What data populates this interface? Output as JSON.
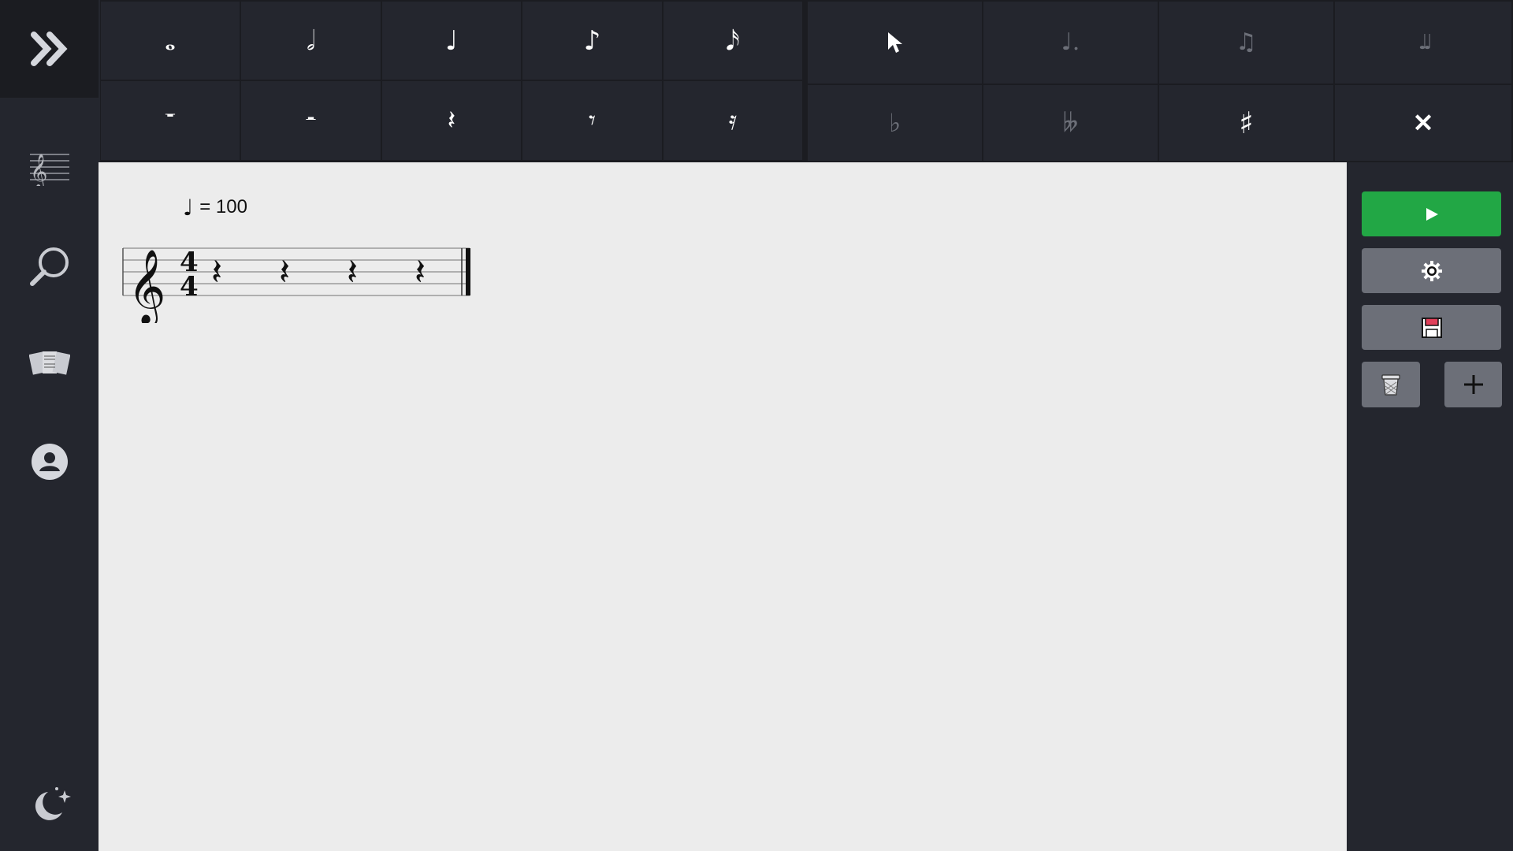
{
  "palette": {
    "durations": [
      {
        "name": "whole-note-icon",
        "glyph": "𝅝",
        "active": true
      },
      {
        "name": "half-note-icon",
        "glyph": "𝅗𝅥",
        "active": true
      },
      {
        "name": "quarter-note-icon",
        "glyph": "♩",
        "active": true
      },
      {
        "name": "eighth-note-icon",
        "glyph": "♪",
        "active": true
      },
      {
        "name": "sixteenth-note-icon",
        "glyph": "𝅘𝅥𝅯",
        "active": true
      }
    ],
    "rests": [
      {
        "name": "whole-rest-icon",
        "glyph": "𝄻",
        "active": true
      },
      {
        "name": "half-rest-icon",
        "glyph": "𝄼",
        "active": true
      },
      {
        "name": "quarter-rest-icon",
        "glyph": "𝄽",
        "active": true
      },
      {
        "name": "eighth-rest-icon",
        "glyph": "𝄾",
        "active": true
      },
      {
        "name": "sixteenth-rest-icon",
        "glyph": "𝄿",
        "active": true
      }
    ],
    "tools_top": [
      {
        "name": "select-cursor-icon",
        "active": true
      },
      {
        "name": "dotted-note-icon",
        "glyph": "♩.",
        "active": false
      },
      {
        "name": "triplet-icon",
        "glyph": "♫",
        "active": false
      },
      {
        "name": "tie-icon",
        "glyph": "♩♩",
        "active": false
      }
    ],
    "tools_bottom": [
      {
        "name": "flat-icon",
        "glyph": "♭",
        "active": false
      },
      {
        "name": "double-flat-icon",
        "glyph": "𝄫",
        "active": false
      },
      {
        "name": "sharp-icon",
        "glyph": "♯",
        "active": true
      },
      {
        "name": "natural-close-icon",
        "glyph": "✕",
        "active": true
      }
    ]
  },
  "score": {
    "tempo_note": "♩",
    "tempo_text": "= 100",
    "clef": "𝄞",
    "time_signature": {
      "top": "4",
      "bottom": "4"
    },
    "rest_glyph": "𝄽",
    "rests_count": 4
  },
  "colors": {
    "play": "#22a745",
    "button_gray": "#6c6f78",
    "panel": "#24262e",
    "sheet": "#ececec"
  }
}
